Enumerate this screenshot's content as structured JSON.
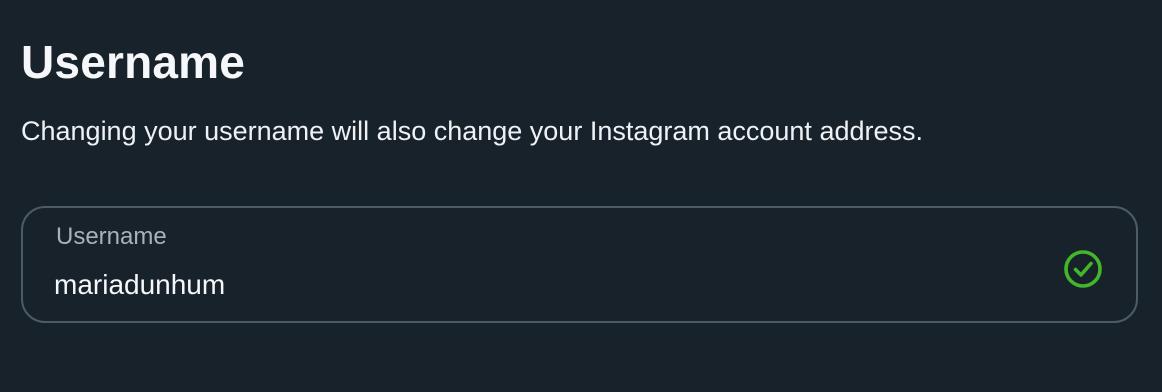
{
  "section": {
    "title": "Username",
    "description": "Changing your username will also change your Instagram account address."
  },
  "username_field": {
    "label": "Username",
    "value": "mariadunhum",
    "status_icon": "check-circle-icon",
    "status_color": "#42b72a"
  }
}
